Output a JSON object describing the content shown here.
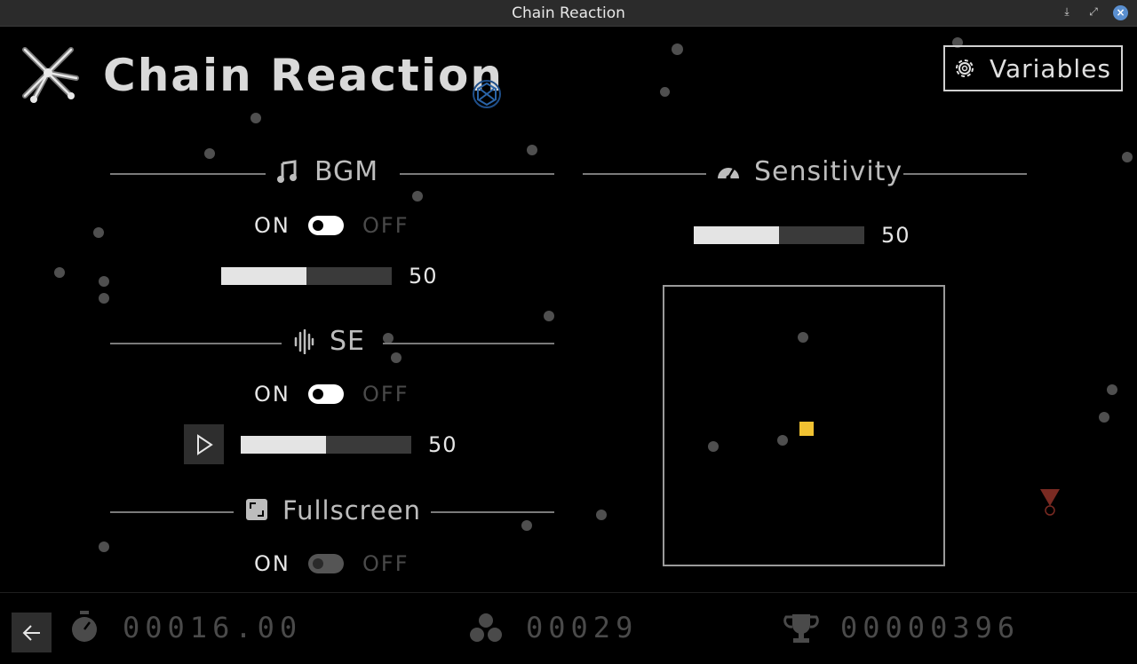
{
  "window": {
    "title": "Chain Reaction",
    "download_icon": "download-icon",
    "maximize_icon": "maximize-icon",
    "close_icon": "close-icon"
  },
  "header": {
    "title": "Chain Reaction",
    "variables_label": "Variables"
  },
  "bgm": {
    "title": "BGM",
    "on_label": "ON",
    "off_label": "OFF",
    "enabled": true,
    "volume": 50,
    "volume_label": "50"
  },
  "se": {
    "title": "SE",
    "on_label": "ON",
    "off_label": "OFF",
    "enabled": true,
    "volume": 50,
    "volume_label": "50"
  },
  "fullscreen": {
    "title": "Fullscreen",
    "on_label": "ON",
    "off_label": "OFF",
    "enabled": true,
    "disabled": true
  },
  "sensitivity": {
    "title": "Sensitivity",
    "value": 50,
    "value_label": "50"
  },
  "stats": {
    "time": "00016.00",
    "count": "00029",
    "score": "00000396"
  },
  "colors": {
    "accent_target": "#f1c232",
    "particle": "#4f4f4f",
    "hazard": "#7a2a22"
  }
}
